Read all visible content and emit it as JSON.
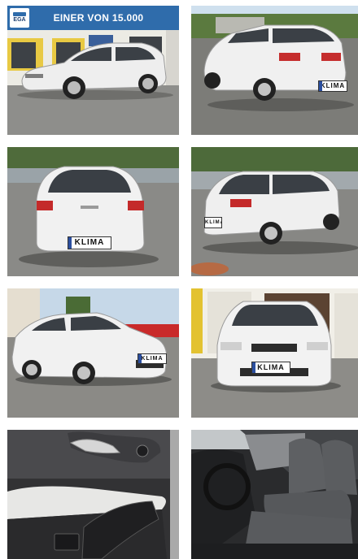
{
  "banner": {
    "text": "EINER VON 15.000",
    "logo_text": "EGA",
    "color": "#2f6cab"
  },
  "vehicle": {
    "plate_text": "KLIMA",
    "body_color": "#f2f2f2"
  },
  "gallery": {
    "photos": [
      {
        "name": "front-left-exterior"
      },
      {
        "name": "rear-right-exterior"
      },
      {
        "name": "rear-exterior"
      },
      {
        "name": "rear-left-exterior"
      },
      {
        "name": "front-right-exterior"
      },
      {
        "name": "front-exterior"
      },
      {
        "name": "door-panel-interior"
      },
      {
        "name": "front-seats-interior"
      }
    ]
  }
}
